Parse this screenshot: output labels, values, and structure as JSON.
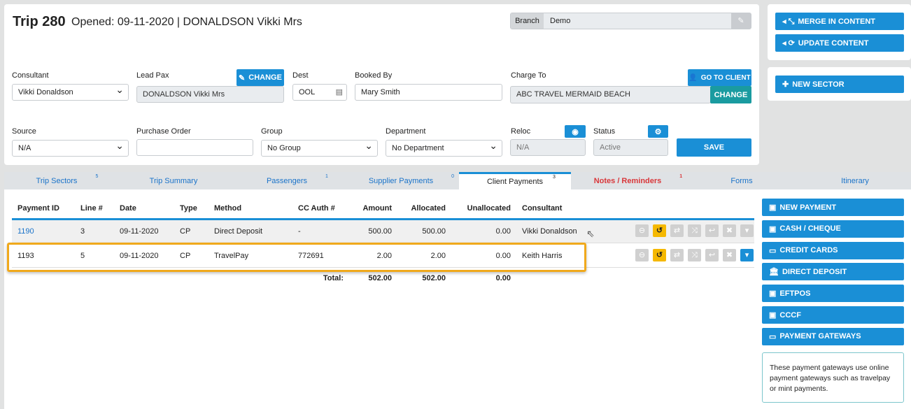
{
  "header": {
    "trip": "Trip 280",
    "opened": "Opened: 09-11-2020 | DONALDSON Vikki Mrs",
    "branch_label": "Branch",
    "branch_value": "Demo"
  },
  "form": {
    "consultant_label": "Consultant",
    "consultant_value": "Vikki Donaldson",
    "leadpax_label": "Lead Pax",
    "leadpax_value": "DONALDSON Vikki Mrs",
    "change_label": "CHANGE",
    "dest_label": "Dest",
    "dest_value": "OOL",
    "bookedby_label": "Booked By",
    "bookedby_value": "Mary Smith",
    "chargeto_label": "Charge To",
    "chargeto_value": "ABC TRAVEL MERMAID BEACH",
    "goto_client": "GO TO CLIENT",
    "chargeto_change": "CHANGE",
    "source_label": "Source",
    "source_value": "N/A",
    "po_label": "Purchase Order",
    "po_value": "",
    "group_label": "Group",
    "group_value": "No Group",
    "dept_label": "Department",
    "dept_value": "No Department",
    "reloc_label": "Reloc",
    "reloc_value": "N/A",
    "status_label": "Status",
    "status_value": "Active",
    "save": "SAVE"
  },
  "side_top": {
    "merge": "MERGE IN CONTENT",
    "update": "UPDATE CONTENT",
    "new_sector": "NEW SECTOR"
  },
  "tabs": [
    {
      "label": "Trip Sectors",
      "count": "5"
    },
    {
      "label": "Trip Summary",
      "count": ""
    },
    {
      "label": "Passengers",
      "count": "1"
    },
    {
      "label": "Supplier Payments",
      "count": "0"
    },
    {
      "label": "Client Payments",
      "count": "3"
    },
    {
      "label": "Notes / Reminders",
      "count": "1"
    },
    {
      "label": "Forms",
      "count": ""
    },
    {
      "label": "Itinerary",
      "count": ""
    }
  ],
  "table": {
    "headers": [
      "Payment ID",
      "Line #",
      "Date",
      "Type",
      "Method",
      "CC Auth #",
      "Amount",
      "Allocated",
      "Unallocated",
      "Consultant"
    ],
    "rows": [
      [
        "1190",
        "3",
        "09-11-2020",
        "CP",
        "Direct Deposit",
        "-",
        "500.00",
        "500.00",
        "0.00",
        "Vikki Donaldson"
      ],
      [
        "1193",
        "5",
        "09-11-2020",
        "CP",
        "TravelPay",
        "772691",
        "2.00",
        "2.00",
        "0.00",
        "Keith Harris"
      ]
    ],
    "total_label": "Total:",
    "total_amount": "502.00",
    "total_allocated": "502.00",
    "total_unallocated": "0.00"
  },
  "payments": {
    "buttons": [
      "NEW PAYMENT",
      "CASH / CHEQUE",
      "CREDIT CARDS",
      "DIRECT DEPOSIT",
      "EFTPOS",
      "CCCF",
      "PAYMENT GATEWAYS"
    ],
    "note": "These payment gateways use online payment gateways such as travelpay or mint payments."
  },
  "colors": {
    "primary": "#1a8fd6",
    "teal": "#1a9ba0",
    "highlight": "#f0a91c",
    "warn": "#f5b800"
  }
}
